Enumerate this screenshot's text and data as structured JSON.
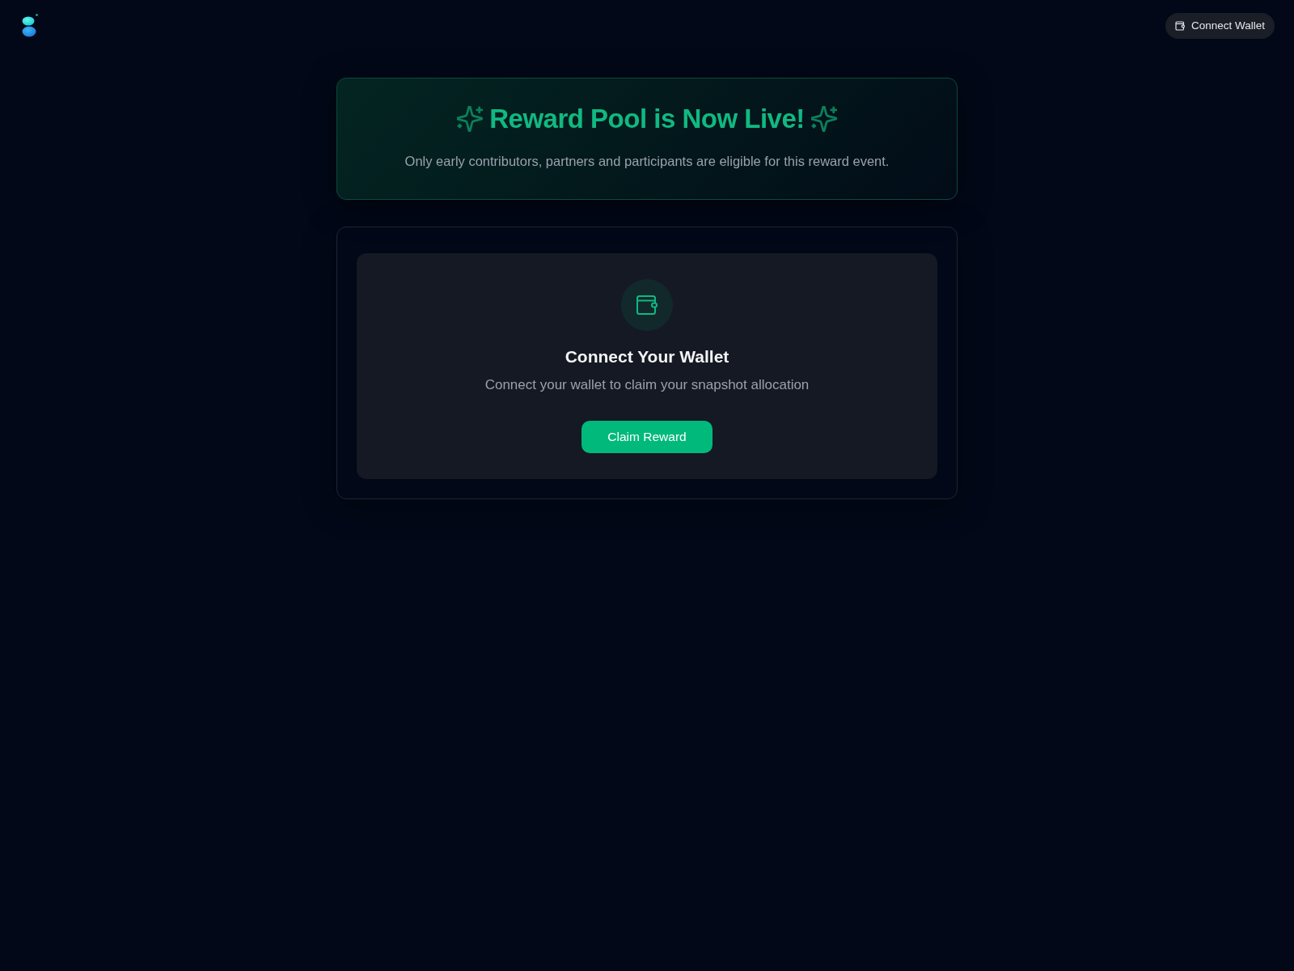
{
  "header": {
    "connect_button": {
      "label": "Connect Wallet"
    }
  },
  "banner": {
    "title": "Reward Pool is Now Live!",
    "subtitle": "Only early contributors, partners and participants are eligible for this reward event."
  },
  "wallet_panel": {
    "title": "Connect Your Wallet",
    "subtitle": "Connect your wallet to claim your snapshot allocation",
    "button": {
      "label": "Claim Reward"
    }
  }
}
